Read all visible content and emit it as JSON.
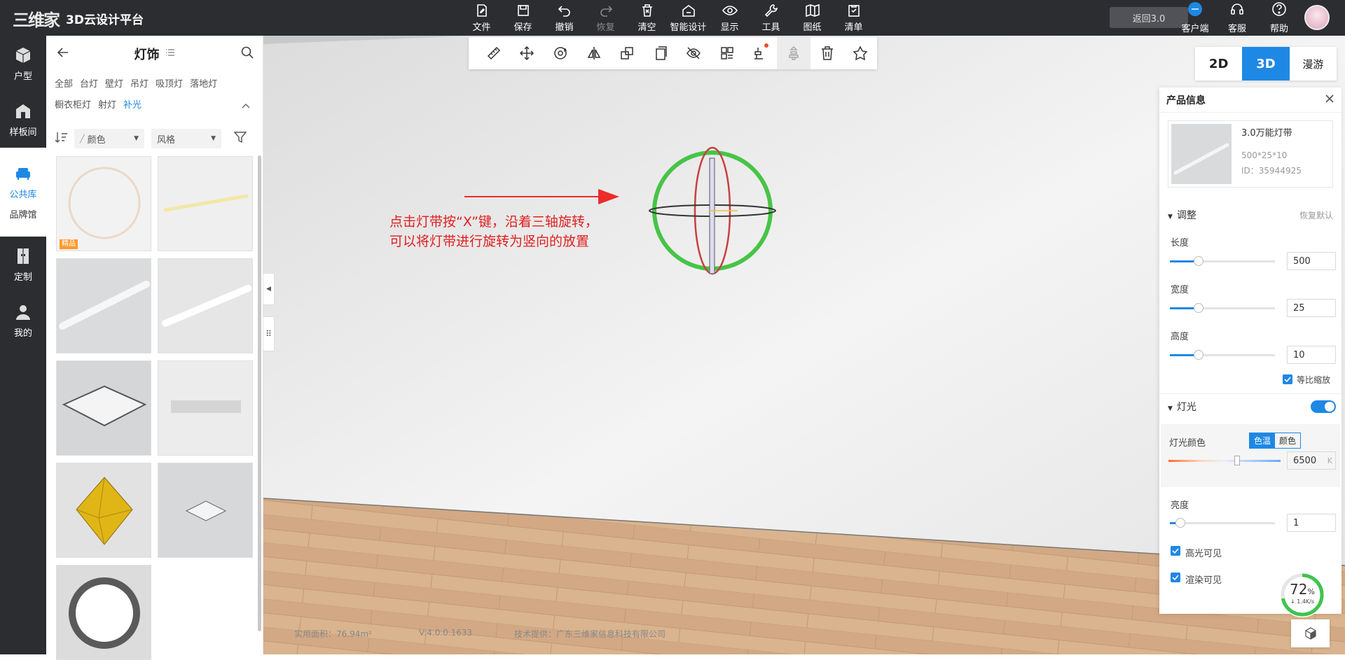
{
  "app": {
    "logo_mark": "三维家",
    "title": "3D云设计平台"
  },
  "top_menu": [
    {
      "key": "file",
      "label": "文件"
    },
    {
      "key": "save",
      "label": "保存"
    },
    {
      "key": "undo",
      "label": "撤销"
    },
    {
      "key": "redo",
      "label": "恢复"
    },
    {
      "key": "clear",
      "label": "清空"
    },
    {
      "key": "smart",
      "label": "智能设计"
    },
    {
      "key": "display",
      "label": "显示"
    },
    {
      "key": "tools",
      "label": "工具"
    },
    {
      "key": "drawings",
      "label": "图纸"
    },
    {
      "key": "list",
      "label": "清单"
    }
  ],
  "back_button": "返回3.0",
  "top_right": [
    {
      "key": "client",
      "label": "客户端"
    },
    {
      "key": "service",
      "label": "客服"
    },
    {
      "key": "help",
      "label": "帮助"
    }
  ],
  "rail": [
    {
      "key": "floorplan",
      "label": "户型"
    },
    {
      "key": "showroom",
      "label": "样板间"
    },
    {
      "key": "public",
      "label": "公共库",
      "sub": "品牌馆"
    },
    {
      "key": "custom",
      "label": "定制"
    },
    {
      "key": "mine",
      "label": "我的"
    }
  ],
  "library": {
    "title": "灯饰",
    "categories": [
      "全部",
      "台灯",
      "壁灯",
      "吊灯",
      "吸顶灯",
      "落地灯",
      "橱衣柜灯",
      "射灯",
      "补光"
    ],
    "active_category": "补光",
    "filter_color": "颜色",
    "filter_style": "风格",
    "badge": "精品"
  },
  "view_modes": [
    "2D",
    "3D",
    "漫游"
  ],
  "active_view": "3D",
  "annotation": {
    "line1": "点击灯带按“X”键，沿着三轴旋转，",
    "line2": "可以将灯带进行旋转为竖向的放置"
  },
  "panel": {
    "title": "产品信息",
    "product_name": "3.0万能灯带",
    "product_size": "500*25*10",
    "product_id": "ID：35944925",
    "adjust_label": "调整",
    "reset_label": "恢复默认",
    "length_label": "长度",
    "length_value": "500",
    "width_label": "宽度",
    "width_value": "25",
    "height_label": "高度",
    "height_value": "10",
    "lock_ratio_label": "等比缩放",
    "light_label": "灯光",
    "light_color_label": "灯光颜色",
    "seg_temp": "色温",
    "seg_color": "颜色",
    "temp_value": "6500",
    "temp_unit": "K",
    "brightness_label": "亮度",
    "brightness_value": "1",
    "specular_label": "高光可见",
    "render_label": "渲染可见"
  },
  "progress": {
    "percent": "72",
    "unit": "%",
    "speed": "↓ 1.4K/s"
  },
  "footer": {
    "area": "实用面积：76.94m²",
    "version": "V:4.0.0.1633",
    "provider": "技术提供：广东三维家信息科技有限公司"
  },
  "colors": {
    "accent": "#1e88e5",
    "topbar": "#2c2d30",
    "annotation": "#e02020"
  }
}
